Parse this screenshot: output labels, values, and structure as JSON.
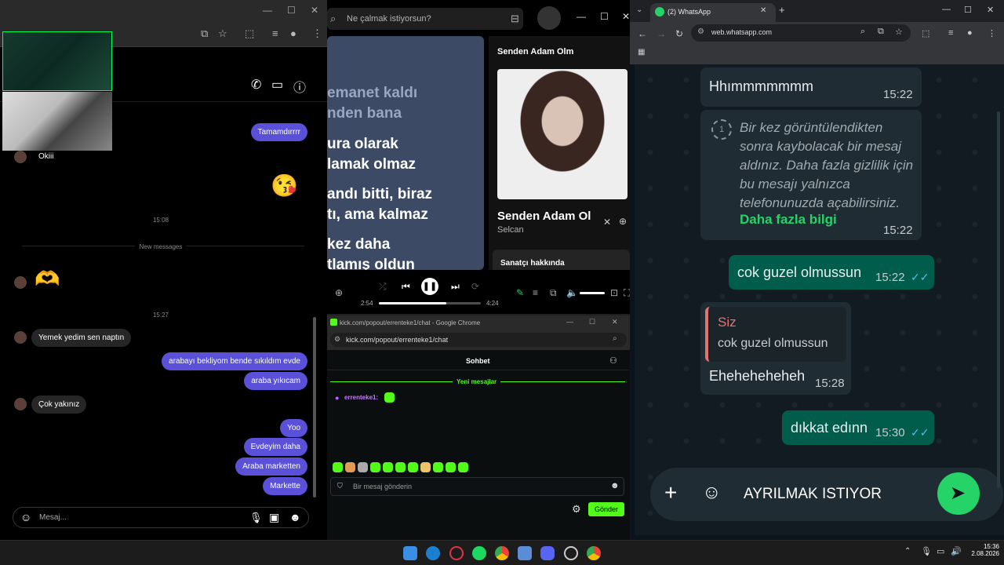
{
  "instagram": {
    "messages": [
      {
        "dir": "out",
        "text": "Tamamdırrrr"
      },
      {
        "dir": "in",
        "text": "Okiii"
      },
      {
        "dir": "time",
        "text": "15:08"
      },
      {
        "dir": "divider",
        "text": "New messages"
      },
      {
        "dir": "time",
        "text": "15:27"
      },
      {
        "dir": "in",
        "text": "Yemek yedim sen naptın"
      },
      {
        "dir": "out",
        "text": "arabayı bekliyom bende sıkıldım evde"
      },
      {
        "dir": "out",
        "text": "araba yıkıcam"
      },
      {
        "dir": "in",
        "text": "Çok yakınız"
      },
      {
        "dir": "out",
        "text": "Yoo"
      },
      {
        "dir": "out",
        "text": "Evdeyim daha"
      },
      {
        "dir": "out",
        "text": "Araba marketten"
      },
      {
        "dir": "out",
        "text": "Markette"
      }
    ],
    "composer_placeholder": "Mesaj...",
    "emoji_kiss": "😘",
    "emoji_heart": "🫶"
  },
  "spotify": {
    "search_placeholder": "Ne çalmak istiyorsun?",
    "lyrics": [
      "emanet kaldı",
      "nden bana",
      "ura olarak",
      "lamak olmaz",
      "andı bitti, biraz",
      "tı, ama kalmaz",
      "kez daha",
      "tlamış oldun"
    ],
    "panel_title": "Senden Adam Olm",
    "track_title": "Senden Adam Ol",
    "artist": "Selcan",
    "about_label": "Sanatçı hakkında",
    "time_elapsed": "2:54",
    "time_total": "4:24",
    "progress": 0.66
  },
  "kick": {
    "window_title": "kick.com/popout/errenteke1/chat - Google Chrome",
    "url": "kick.com/popout/errenteke1/chat",
    "chat_title": "Sohbet",
    "new_messages": "Yeni mesajlar",
    "username": "errenteke1:",
    "input_placeholder": "Bir mesaj gönderin",
    "send_label": "Gönder"
  },
  "whatsapp": {
    "tab_title": "(2) WhatsApp",
    "url": "web.whatsapp.com",
    "msg1": {
      "text": "Hhımmmmmmm",
      "time": "15:22"
    },
    "viewonce": {
      "text": "Bir kez görüntülendikten sonra kaybolacak bir mesaj aldınız. Daha fazla gizlilik için bu mesajı yalnızca telefonunuzda açabilirsiniz.",
      "link": "Daha fazla bilgi",
      "time": "15:22"
    },
    "out1": {
      "text": "cok guzel olmussun",
      "time": "15:22"
    },
    "reply": {
      "quote_author": "Siz",
      "quote_text": "cok guzel olmussun",
      "text": "Ehehehehеheh",
      "time": "15:28"
    },
    "out2": {
      "text": "dıkkat edınn",
      "time": "15:30"
    },
    "composer_text": "AYRILMAK ISTIYOR"
  },
  "taskbar": {
    "time": "15:36",
    "date": "2.08.2026"
  }
}
